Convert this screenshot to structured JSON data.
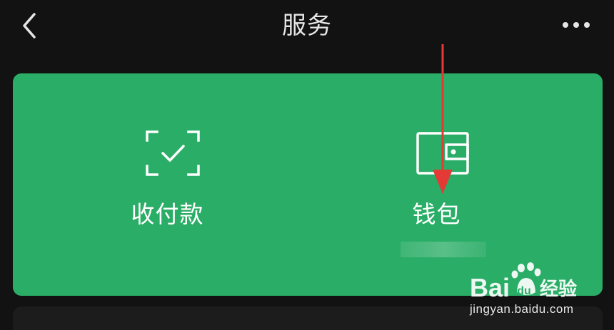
{
  "header": {
    "title": "服务"
  },
  "services": [
    {
      "label": "收付款",
      "icon": "scan-check-icon"
    },
    {
      "label": "钱包",
      "icon": "wallet-icon"
    }
  ],
  "watermark": {
    "brand": "Baidu经验",
    "url": "jingyan.baidu.com"
  },
  "colors": {
    "background": "#121212",
    "card": "#2aad66",
    "arrow": "#e53935",
    "text": "#ffffff"
  }
}
